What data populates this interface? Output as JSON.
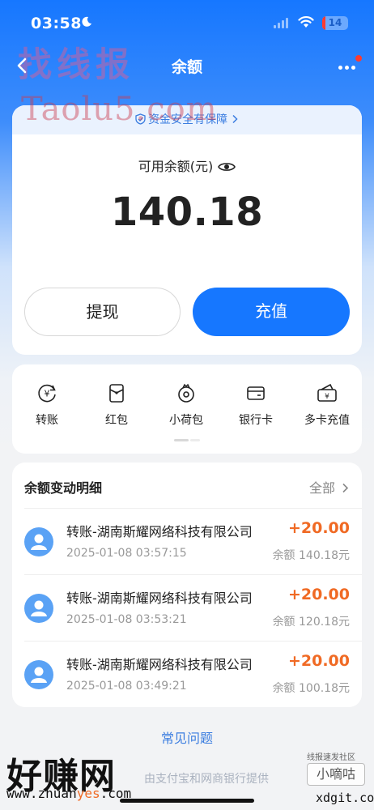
{
  "status_bar": {
    "time": "03:58",
    "battery": "14"
  },
  "nav": {
    "title": "余额"
  },
  "watermarks": {
    "top_chinese": "找线报",
    "top_latin": "Taolu5.com",
    "bottom_big": "好赚网",
    "bottom_url_prefix": "www.zhuan",
    "bottom_url_highlight": "yes",
    "bottom_url_suffix": ".com",
    "forum": "线报速发社区",
    "forum_name": "小嘀咕",
    "forum_url": "xdgit.com"
  },
  "balance": {
    "safety_text": "资金安全有保障",
    "label": "可用余额(元)",
    "amount": "140.18",
    "withdraw_label": "提现",
    "recharge_label": "充值"
  },
  "actions": [
    {
      "label": "转账",
      "icon": "transfer-icon"
    },
    {
      "label": "红包",
      "icon": "red-packet-icon"
    },
    {
      "label": "小荷包",
      "icon": "purse-icon"
    },
    {
      "label": "银行卡",
      "icon": "bank-card-icon"
    },
    {
      "label": "多卡充值",
      "icon": "multi-card-icon"
    }
  ],
  "transactions": {
    "title": "余额变动明细",
    "all_label": "全部",
    "items": [
      {
        "name": "转账-湖南斯耀网络科技有限公司",
        "date": "2025-01-08 03:57:15",
        "amount": "+20.00",
        "balance": "余额 140.18元"
      },
      {
        "name": "转账-湖南斯耀网络科技有限公司",
        "date": "2025-01-08 03:53:21",
        "amount": "+20.00",
        "balance": "余额 120.18元"
      },
      {
        "name": "转账-湖南斯耀网络科技有限公司",
        "date": "2025-01-08 03:49:21",
        "amount": "+20.00",
        "balance": "余额 100.18元"
      }
    ]
  },
  "faq_label": "常见问题",
  "provider_text": "由支付宝和网商银行提供",
  "colors": {
    "primary": "#1677ff",
    "amount_positive": "#f06a24",
    "link": "#3b7de0"
  }
}
